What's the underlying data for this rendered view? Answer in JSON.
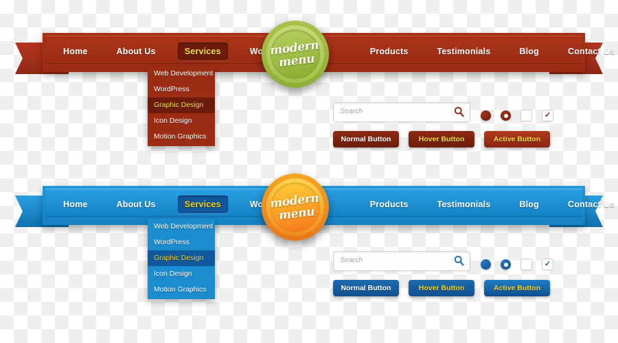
{
  "themes": [
    {
      "name": "red-theme",
      "accent": "#9c2c14",
      "badge": {
        "line1": "modern",
        "line2": "menu",
        "color": "#9cbb41"
      },
      "nav": {
        "items": [
          {
            "label": "Home",
            "active": false
          },
          {
            "label": "About Us",
            "active": false
          },
          {
            "label": "Services",
            "active": true
          },
          {
            "label": "Works",
            "active": false
          },
          {
            "label": "Products",
            "active": false
          },
          {
            "label": "Testimonials",
            "active": false
          },
          {
            "label": "Blog",
            "active": false
          },
          {
            "label": "Contact Us",
            "active": false
          }
        ]
      },
      "dropdown": {
        "items": [
          {
            "label": "Web Development",
            "selected": false
          },
          {
            "label": "WordPress",
            "selected": false
          },
          {
            "label": "Graphic Design",
            "selected": true
          },
          {
            "label": "Icon Design",
            "selected": false
          },
          {
            "label": "Motion Graphics",
            "selected": false
          }
        ]
      },
      "search": {
        "placeholder": "Search",
        "value": "",
        "icon": "search-icon"
      },
      "controls": {
        "radio_selected": true,
        "radio_ring": true,
        "checkbox_unchecked": false,
        "checkbox_checked": true,
        "check_glyph": "✓"
      },
      "buttons": [
        {
          "label": "Normal Button",
          "state": "normal"
        },
        {
          "label": "Hover Button",
          "state": "hover"
        },
        {
          "label": "Active Button",
          "state": "active"
        }
      ]
    },
    {
      "name": "blue-theme",
      "accent": "#1581c5",
      "badge": {
        "line1": "modern",
        "line2": "menu",
        "color": "#fba125"
      },
      "nav": {
        "items": [
          {
            "label": "Home",
            "active": false
          },
          {
            "label": "About Us",
            "active": false
          },
          {
            "label": "Services",
            "active": true
          },
          {
            "label": "Works",
            "active": false
          },
          {
            "label": "Products",
            "active": false
          },
          {
            "label": "Testimonials",
            "active": false
          },
          {
            "label": "Blog",
            "active": false
          },
          {
            "label": "Contact Us",
            "active": false
          }
        ]
      },
      "dropdown": {
        "items": [
          {
            "label": "Web Development",
            "selected": false
          },
          {
            "label": "WordPress",
            "selected": false
          },
          {
            "label": "Graphic Design",
            "selected": true
          },
          {
            "label": "Icon Design",
            "selected": false
          },
          {
            "label": "Motion Graphics",
            "selected": false
          }
        ]
      },
      "search": {
        "placeholder": "Search",
        "value": "",
        "icon": "search-icon"
      },
      "controls": {
        "radio_selected": true,
        "radio_ring": true,
        "checkbox_unchecked": false,
        "checkbox_checked": true,
        "check_glyph": "✓"
      },
      "buttons": [
        {
          "label": "Normal Button",
          "state": "normal"
        },
        {
          "label": "Hover Button",
          "state": "hover"
        },
        {
          "label": "Active Button",
          "state": "active"
        }
      ]
    }
  ]
}
